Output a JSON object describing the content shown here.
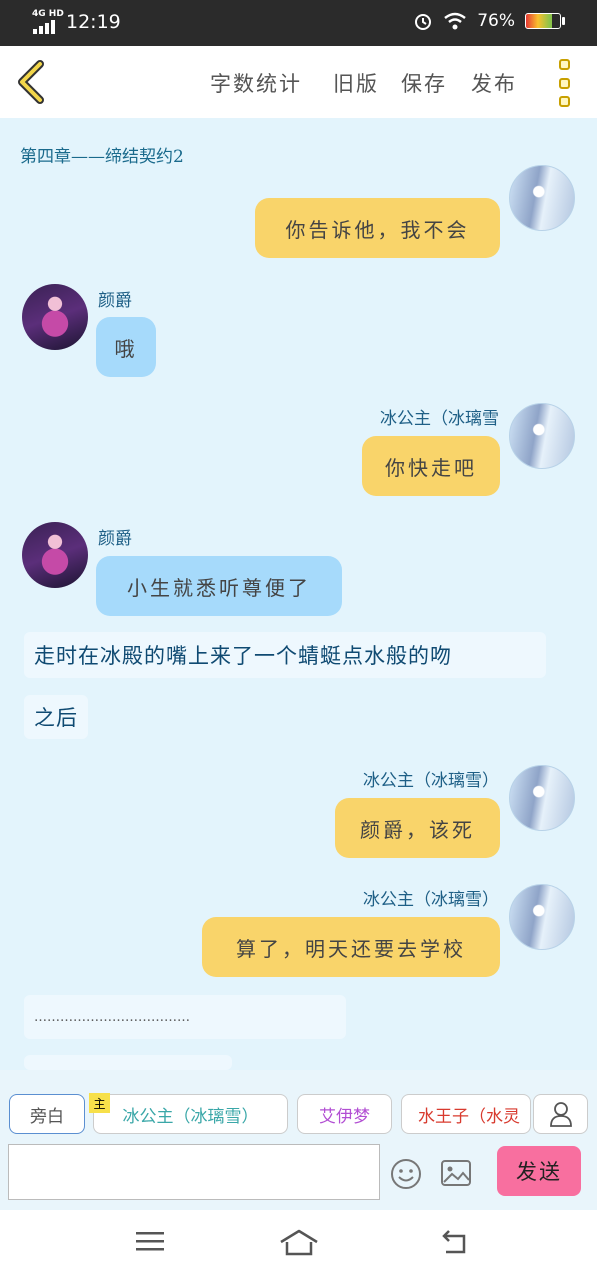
{
  "status": {
    "network": "4G HD",
    "time": "12:19",
    "battery": "76%"
  },
  "toolbar": {
    "word_count": "字数统计",
    "old_version": "旧版",
    "save": "保存",
    "publish": "发布"
  },
  "chapter_title": "第四章——缔结契约2",
  "messages": [
    {
      "speaker": "",
      "text": "你告诉他，我不会",
      "side": "right"
    },
    {
      "speaker": "颜爵",
      "text": "哦",
      "side": "left"
    },
    {
      "speaker": "冰公主（冰璃雪",
      "text": "你快走吧",
      "side": "right"
    },
    {
      "speaker": "颜爵",
      "text": "小生就悉听尊便了",
      "side": "left"
    },
    {
      "speaker": "冰公主（冰璃雪）",
      "text": "颜爵，该死",
      "side": "right"
    },
    {
      "speaker": "冰公主（冰璃雪）",
      "text": "算了，明天还要去学校",
      "side": "right"
    }
  ],
  "narration": [
    "走时在冰殿的嘴上来了一个蜻蜓点水般的吻",
    "之后",
    "………………………………"
  ],
  "role_bar": {
    "narrator": "旁白",
    "main_tag": "主",
    "roles": [
      "冰公主（冰璃雪）",
      "艾伊梦",
      "水王子（水灵"
    ]
  },
  "composer": {
    "value": "",
    "send": "发送"
  },
  "colors": {
    "accent_yellow": "#f9d46a",
    "accent_blue": "#a6dafb",
    "send_pink": "#f86f9f",
    "background": "#e3f4fc"
  }
}
